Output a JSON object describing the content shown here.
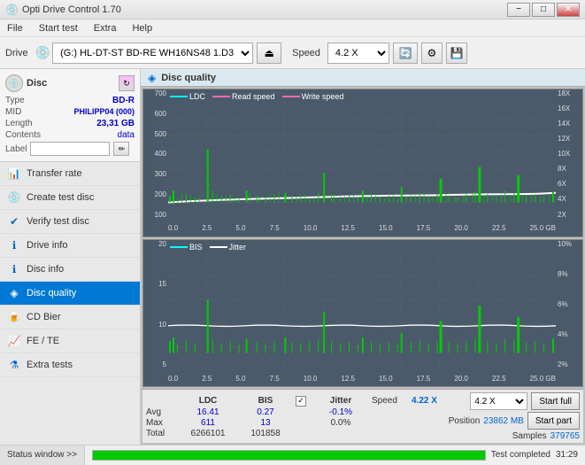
{
  "titleBar": {
    "title": "Opti Drive Control 1.70",
    "minimize": "−",
    "maximize": "□",
    "close": "✕"
  },
  "menuBar": {
    "items": [
      "File",
      "Start test",
      "Extra",
      "Help"
    ]
  },
  "toolbar": {
    "driveLabel": "Drive",
    "driveValue": "(G:) HL-DT-ST BD-RE  WH16NS48 1.D3",
    "speedLabel": "Speed",
    "speedValue": "4.2 X"
  },
  "sidebar": {
    "disc": {
      "title": "Disc",
      "typeLabel": "Type",
      "typeValue": "BD-R",
      "midLabel": "MID",
      "midValue": "PHILIPP04 (000)",
      "lengthLabel": "Length",
      "lengthValue": "23,31 GB",
      "contentsLabel": "Contents",
      "contentsValue": "data",
      "labelLabel": "Label",
      "labelValue": ""
    },
    "navItems": [
      {
        "id": "transfer-rate",
        "label": "Transfer rate",
        "icon": "◈"
      },
      {
        "id": "create-test-disc",
        "label": "Create test disc",
        "icon": "◈"
      },
      {
        "id": "verify-test-disc",
        "label": "Verify test disc",
        "icon": "◈"
      },
      {
        "id": "drive-info",
        "label": "Drive info",
        "icon": "◈"
      },
      {
        "id": "disc-info",
        "label": "Disc info",
        "icon": "◈"
      },
      {
        "id": "disc-quality",
        "label": "Disc quality",
        "icon": "◈",
        "active": true
      },
      {
        "id": "cd-bier",
        "label": "CD Bier",
        "icon": "◈"
      },
      {
        "id": "fe-te",
        "label": "FE / TE",
        "icon": "◈"
      },
      {
        "id": "extra-tests",
        "label": "Extra tests",
        "icon": "◈"
      }
    ],
    "statusBtn": "Status window >>"
  },
  "content": {
    "headerTitle": "Disc quality",
    "chart1": {
      "legend": [
        {
          "label": "LDC",
          "color": "#00ffff"
        },
        {
          "label": "Read speed",
          "color": "#ff69b4"
        },
        {
          "label": "Write speed",
          "color": "#ff69b4"
        }
      ],
      "yLabels": [
        "700",
        "600",
        "500",
        "400",
        "300",
        "200",
        "100"
      ],
      "yLabelsRight": [
        "18X",
        "16X",
        "14X",
        "12X",
        "10X",
        "8X",
        "6X",
        "4X",
        "2X"
      ],
      "xLabels": [
        "0.0",
        "2.5",
        "5.0",
        "7.5",
        "10.0",
        "12.5",
        "15.0",
        "17.5",
        "20.0",
        "22.5",
        "25.0 GB"
      ]
    },
    "chart2": {
      "legend": [
        {
          "label": "BIS",
          "color": "#00ffff"
        },
        {
          "label": "Jitter",
          "color": "#ffffff"
        }
      ],
      "yLabels": [
        "20",
        "15",
        "10",
        "5"
      ],
      "yLabelsRight": [
        "10%",
        "8%",
        "6%",
        "4%",
        "2%"
      ],
      "xLabels": [
        "0.0",
        "2.5",
        "5.0",
        "7.5",
        "10.0",
        "12.5",
        "15.0",
        "17.5",
        "20.0",
        "22.5",
        "25.0 GB"
      ]
    },
    "stats": {
      "headers": [
        "LDC",
        "BIS",
        "",
        "Jitter",
        "Speed",
        "",
        ""
      ],
      "avgLabel": "Avg",
      "avgLDC": "16.41",
      "avgBIS": "0.27",
      "avgJitter": "-0.1%",
      "maxLabel": "Max",
      "maxLDC": "611",
      "maxBIS": "13",
      "maxJitter": "0.0%",
      "totalLabel": "Total",
      "totalLDC": "6266101",
      "totalBIS": "101858",
      "speedLabel": "Speed",
      "speedValue": "4.22 X",
      "speedSelect": "4.2 X",
      "positionLabel": "Position",
      "positionValue": "23862 MB",
      "samplesLabel": "Samples",
      "samplesValue": "379765",
      "startFull": "Start full",
      "startPart": "Start part"
    }
  },
  "statusBar": {
    "btnLabel": "Status window >>",
    "progressValue": "100.0%",
    "statusText": "Test completed",
    "timeText": "31:29"
  }
}
